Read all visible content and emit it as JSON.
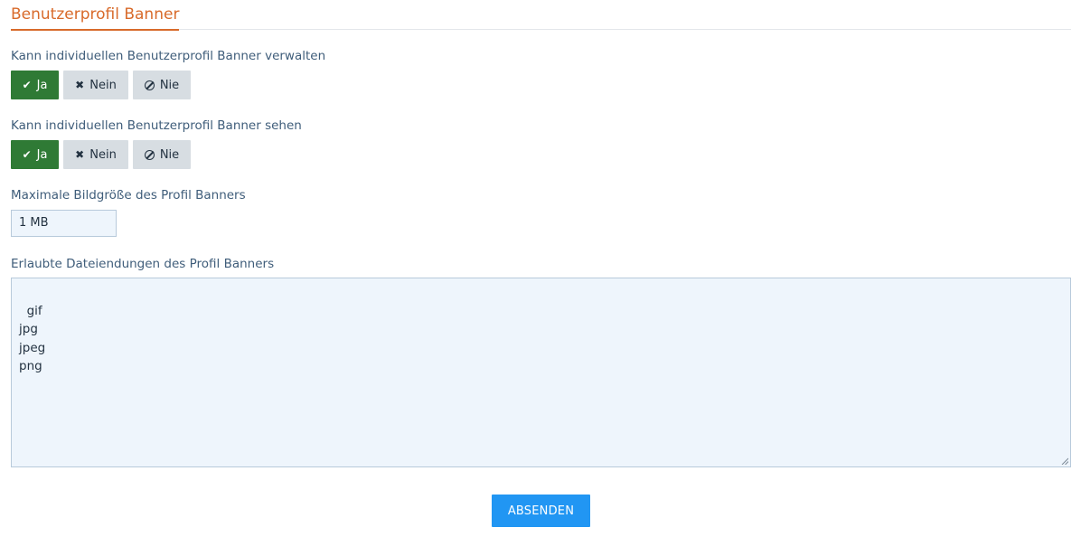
{
  "section": {
    "title": "Benutzerprofil Banner",
    "accent_color": "#d86a2a"
  },
  "manage": {
    "label": "Kann individuellen Benutzerprofil Banner verwalten",
    "options": [
      {
        "label": "Ja",
        "icon": "check-icon",
        "selected": true
      },
      {
        "label": "Nein",
        "icon": "x-icon",
        "selected": false
      },
      {
        "label": "Nie",
        "icon": "never-icon",
        "selected": false
      }
    ]
  },
  "view": {
    "label": "Kann individuellen Benutzerprofil Banner sehen",
    "options": [
      {
        "label": "Ja",
        "icon": "check-icon",
        "selected": true
      },
      {
        "label": "Nein",
        "icon": "x-icon",
        "selected": false
      },
      {
        "label": "Nie",
        "icon": "never-icon",
        "selected": false
      }
    ]
  },
  "max_size": {
    "label": "Maximale Bildgröße des Profil Banners",
    "value": "1 MB"
  },
  "extensions": {
    "label": "Erlaubte Dateiendungen des Profil Banners",
    "value": "gif\njpg\njpeg\npng"
  },
  "submit": {
    "label": "ABSENDEN",
    "color": "#2196f3"
  },
  "colors": {
    "selected_green": "#2f7a35",
    "unselected_gray": "#d7dde2"
  }
}
